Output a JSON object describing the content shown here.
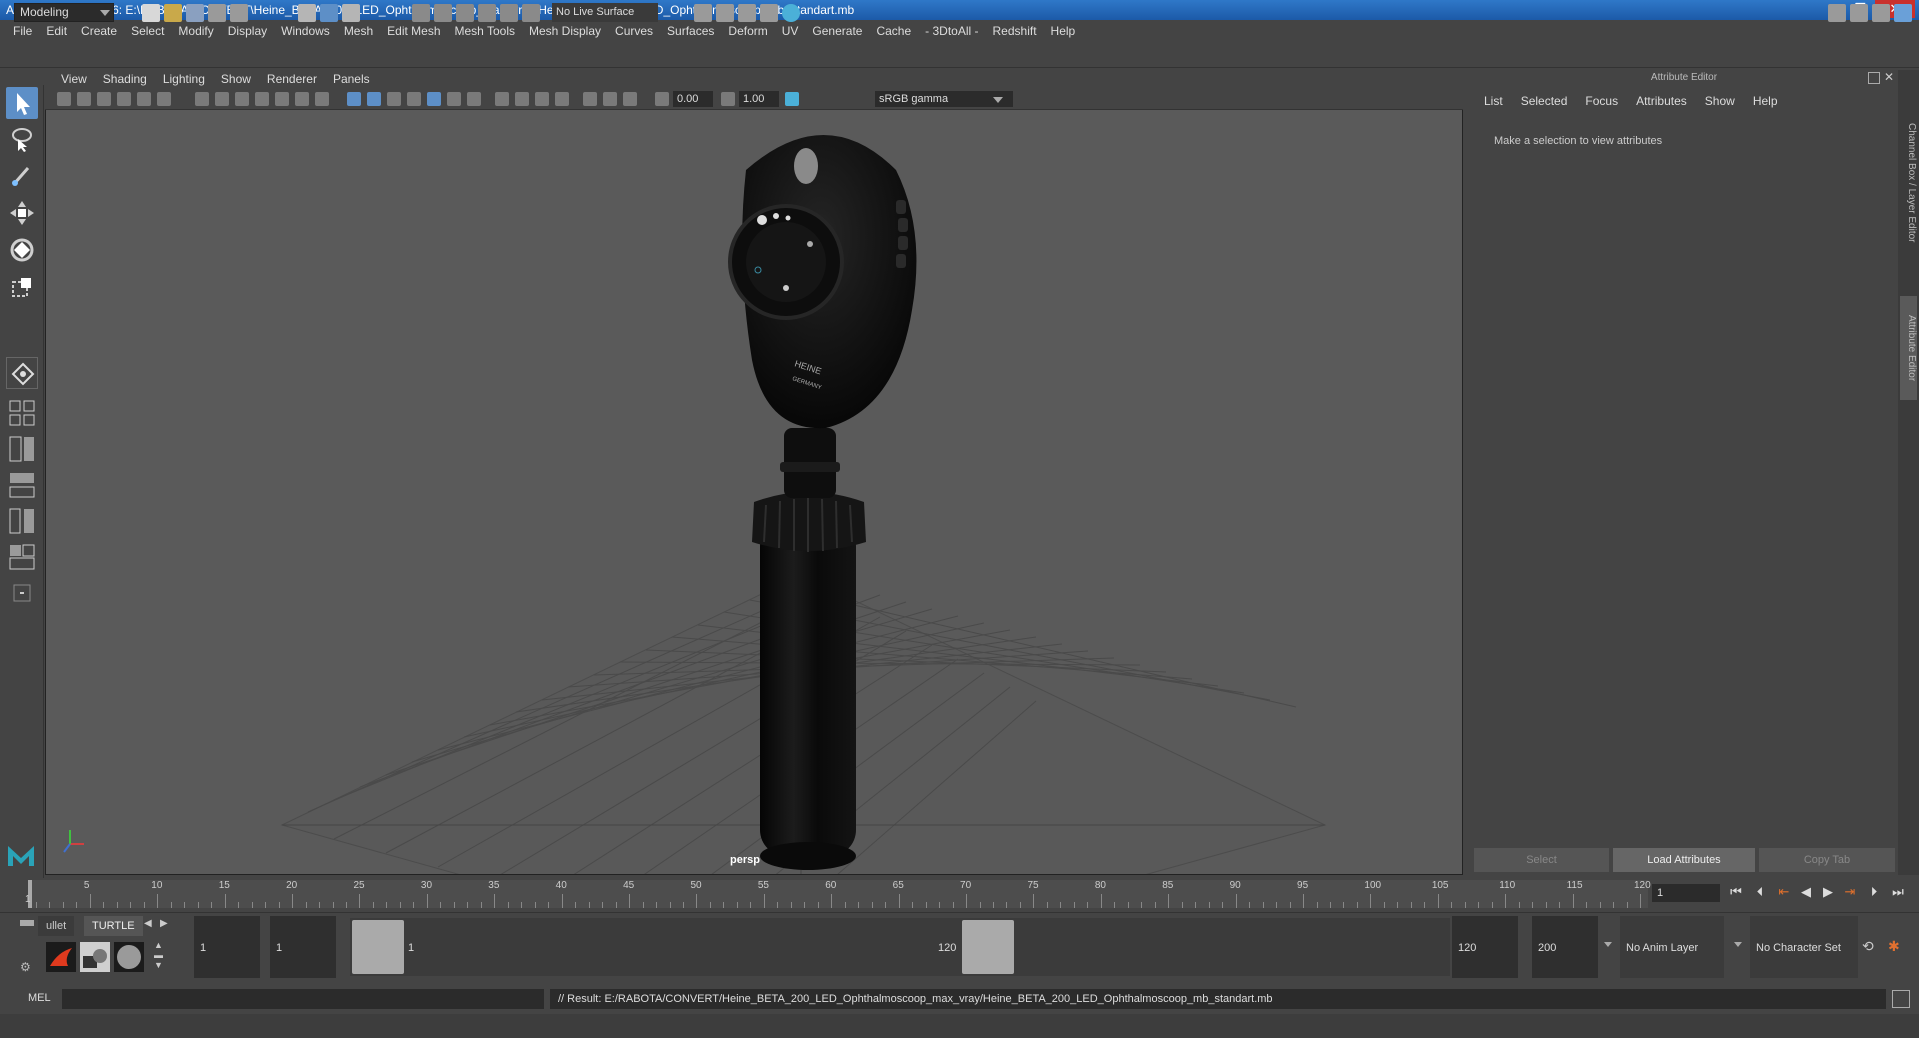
{
  "window": {
    "title": "Autodesk Maya 2016: E:\\RABOTA\\CONVERT\\Heine_BETA_200_LED_Ophthalmoscoop_max_vray\\Heine_BETA_200_LED_Ophthalmoscoop_mb_standart.mb",
    "minimize": "–",
    "maximize": "❐",
    "close": "✕"
  },
  "menu": [
    "File",
    "Edit",
    "Create",
    "Select",
    "Modify",
    "Display",
    "Windows",
    "Mesh",
    "Edit Mesh",
    "Mesh Tools",
    "Mesh Display",
    "Curves",
    "Surfaces",
    "Deform",
    "UV",
    "Generate",
    "Cache",
    "- 3DtoAll -",
    "Redshift",
    "Help"
  ],
  "toolbar": {
    "mode": "Modeling",
    "live_surface": "No Live Surface"
  },
  "viewport": {
    "menu": [
      "View",
      "Shading",
      "Lighting",
      "Show",
      "Renderer",
      "Panels"
    ],
    "exposure": "0.00",
    "gamma_value": "1.00",
    "color_space": "sRGB gamma",
    "camera": "persp",
    "device": {
      "brand_line1": "HEINE",
      "brand_line2": "GERMANY"
    }
  },
  "attribute_editor": {
    "title": "Attribute Editor",
    "menu": [
      "List",
      "Selected",
      "Focus",
      "Attributes",
      "Show",
      "Help"
    ],
    "message": "Make a selection to view attributes",
    "buttons": {
      "select": "Select",
      "load": "Load Attributes",
      "copy_tab": "Copy Tab"
    },
    "side_tabs": {
      "channel_box": "Channel Box / Layer Editor",
      "attribute_editor": "Attribute Editor"
    }
  },
  "timeline": {
    "start_label": "1",
    "tick_labels": [
      "5",
      "10",
      "15",
      "20",
      "25",
      "30",
      "35",
      "40",
      "45",
      "50",
      "55",
      "60",
      "65",
      "70",
      "75",
      "80",
      "85",
      "90",
      "95",
      "100",
      "105",
      "110",
      "115",
      "120"
    ],
    "current_frame": "1",
    "min_frame": 1,
    "max_frame": 120
  },
  "range": {
    "shelf_tabs": [
      "ullet",
      "TURTLE"
    ],
    "start_field": "1",
    "playback_start": "1",
    "range_start_label": "1",
    "range_end_label": "120",
    "playback_end": "120",
    "end_field": "200",
    "anim_layer": "No Anim Layer",
    "character_set": "No Character Set"
  },
  "command_line": {
    "label": "MEL",
    "result": "// Result: E:/RABOTA/CONVERT/Heine_BETA_200_LED_Ophthalmoscoop_max_vray/Heine_BETA_200_LED_Ophthalmoscoop_mb_standart.mb"
  },
  "colors": {
    "accent": "#5d8fc7",
    "title_bar": "#1c5aa8",
    "viewport_bg": "#5a5a5a",
    "device": "#0c0c0c"
  }
}
